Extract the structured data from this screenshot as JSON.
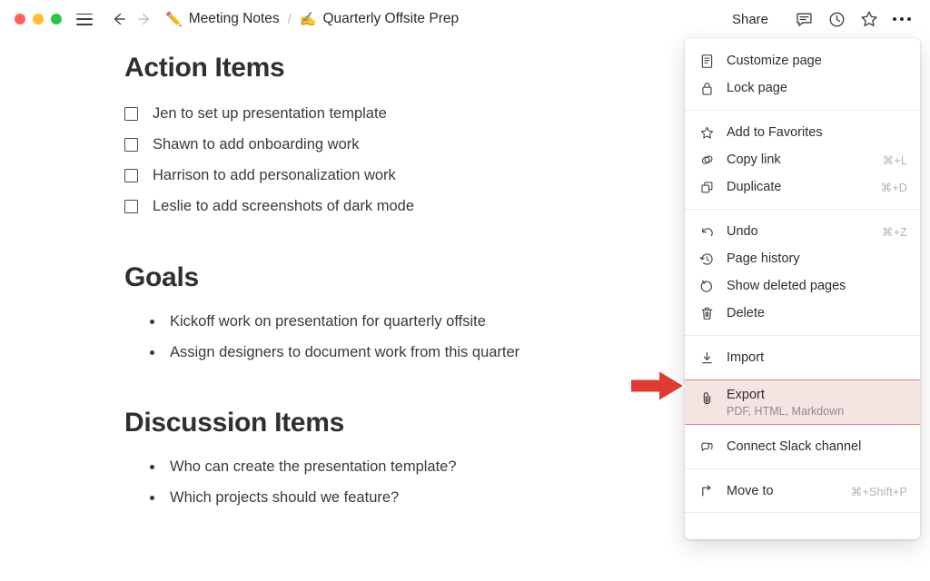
{
  "window": {
    "traffic_lights": [
      "close",
      "minimize",
      "zoom"
    ],
    "sidebar_toggle_icon": "hamburger-icon",
    "back_icon": "arrow-left-icon",
    "forward_icon": "arrow-right-icon"
  },
  "breadcrumb": {
    "parent_emoji": "✏️",
    "parent": "Meeting Notes",
    "separator": "/",
    "current_emoji": "✍️",
    "current": "Quarterly Offsite Prep"
  },
  "toolbar": {
    "share_label": "Share",
    "comment_icon": "comment-icon",
    "history_icon": "clock-icon",
    "favorite_icon": "star-icon",
    "more_icon": "ellipsis-icon"
  },
  "document": {
    "sections": [
      {
        "heading": "Action Items",
        "list_type": "checklist",
        "items": [
          "Jen to set up presentation template",
          "Shawn to add onboarding work",
          "Harrison to add personalization work",
          "Leslie to add screenshots of dark mode"
        ]
      },
      {
        "heading": "Goals",
        "list_type": "bullets",
        "items": [
          "Kickoff work on presentation for quarterly offsite",
          "Assign designers to document work from this quarter"
        ]
      },
      {
        "heading": "Discussion Items",
        "list_type": "bullets",
        "items": [
          "Who can create the presentation template?",
          "Which projects should we feature?"
        ]
      }
    ]
  },
  "menu": {
    "groups": [
      {
        "items": [
          {
            "icon": "document-icon",
            "label": "Customize page",
            "shortcut": ""
          },
          {
            "icon": "lock-icon",
            "label": "Lock page",
            "shortcut": ""
          }
        ]
      },
      {
        "items": [
          {
            "icon": "star-icon",
            "label": "Add to Favorites",
            "shortcut": ""
          },
          {
            "icon": "link-icon",
            "label": "Copy link",
            "shortcut": "⌘+L"
          },
          {
            "icon": "duplicate-icon",
            "label": "Duplicate",
            "shortcut": "⌘+D"
          }
        ]
      },
      {
        "items": [
          {
            "icon": "undo-icon",
            "label": "Undo",
            "shortcut": "⌘+Z"
          },
          {
            "icon": "page-history-icon",
            "label": "Page history",
            "shortcut": ""
          },
          {
            "icon": "restore-icon",
            "label": "Show deleted pages",
            "shortcut": ""
          },
          {
            "icon": "trash-icon",
            "label": "Delete",
            "shortcut": ""
          }
        ]
      },
      {
        "items": [
          {
            "icon": "import-icon",
            "label": "Import",
            "shortcut": ""
          }
        ]
      },
      {
        "items": [
          {
            "icon": "slack-icon",
            "label": "Connect Slack channel",
            "shortcut": ""
          }
        ]
      },
      {
        "items": [
          {
            "icon": "move-to-icon",
            "label": "Move to",
            "shortcut": "⌘+Shift+P"
          }
        ]
      }
    ],
    "export": {
      "icon": "paperclip-icon",
      "label": "Export",
      "sublabel": "PDF, HTML, Markdown",
      "highlight_fill": "#f4e4e2",
      "highlight_border": "#e4837a"
    }
  },
  "annotation": {
    "arrow_icon": "arrow-right-annotation",
    "arrow_color": "#e03b31",
    "arrow_outline": "#ffffff",
    "points_to": "Export"
  }
}
